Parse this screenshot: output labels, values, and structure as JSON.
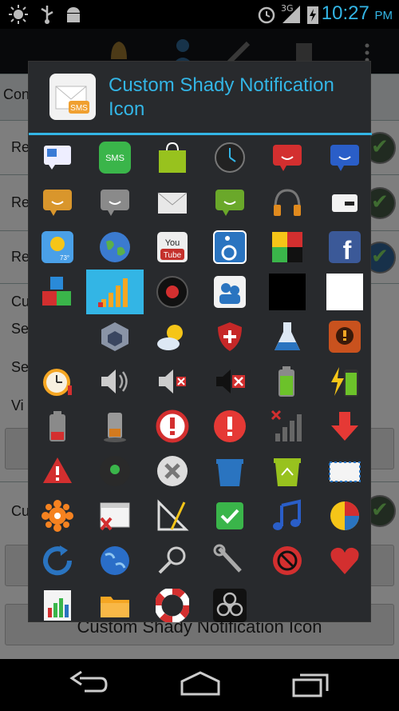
{
  "status_bar": {
    "time": "10:27",
    "ampm": "PM",
    "network": "3G",
    "icons": [
      "brightness-icon",
      "usb-icon",
      "android-debug-icon",
      "alarm-icon",
      "signal-icon",
      "battery-charging-icon"
    ]
  },
  "dialog": {
    "title_line1": "Custom Shady Notification",
    "title_line2": "Icon",
    "icon_label": "SMS",
    "cells": [
      {
        "label": "SMS"
      }
    ],
    "grid_tiles": {
      "youtube_top": "You",
      "youtube_bottom": "Tube",
      "facebook": "f",
      "weather_temp": "73°"
    }
  },
  "background": {
    "rows": [
      "Re",
      "Re",
      "Re",
      "Cu",
      "Se",
      "Se",
      "Vi",
      "Cu",
      "Con"
    ],
    "button_text": "Custom Shady Notification Icon"
  },
  "colors": {
    "accent": "#33b5e5",
    "dialog_bg": "#282a2d"
  }
}
